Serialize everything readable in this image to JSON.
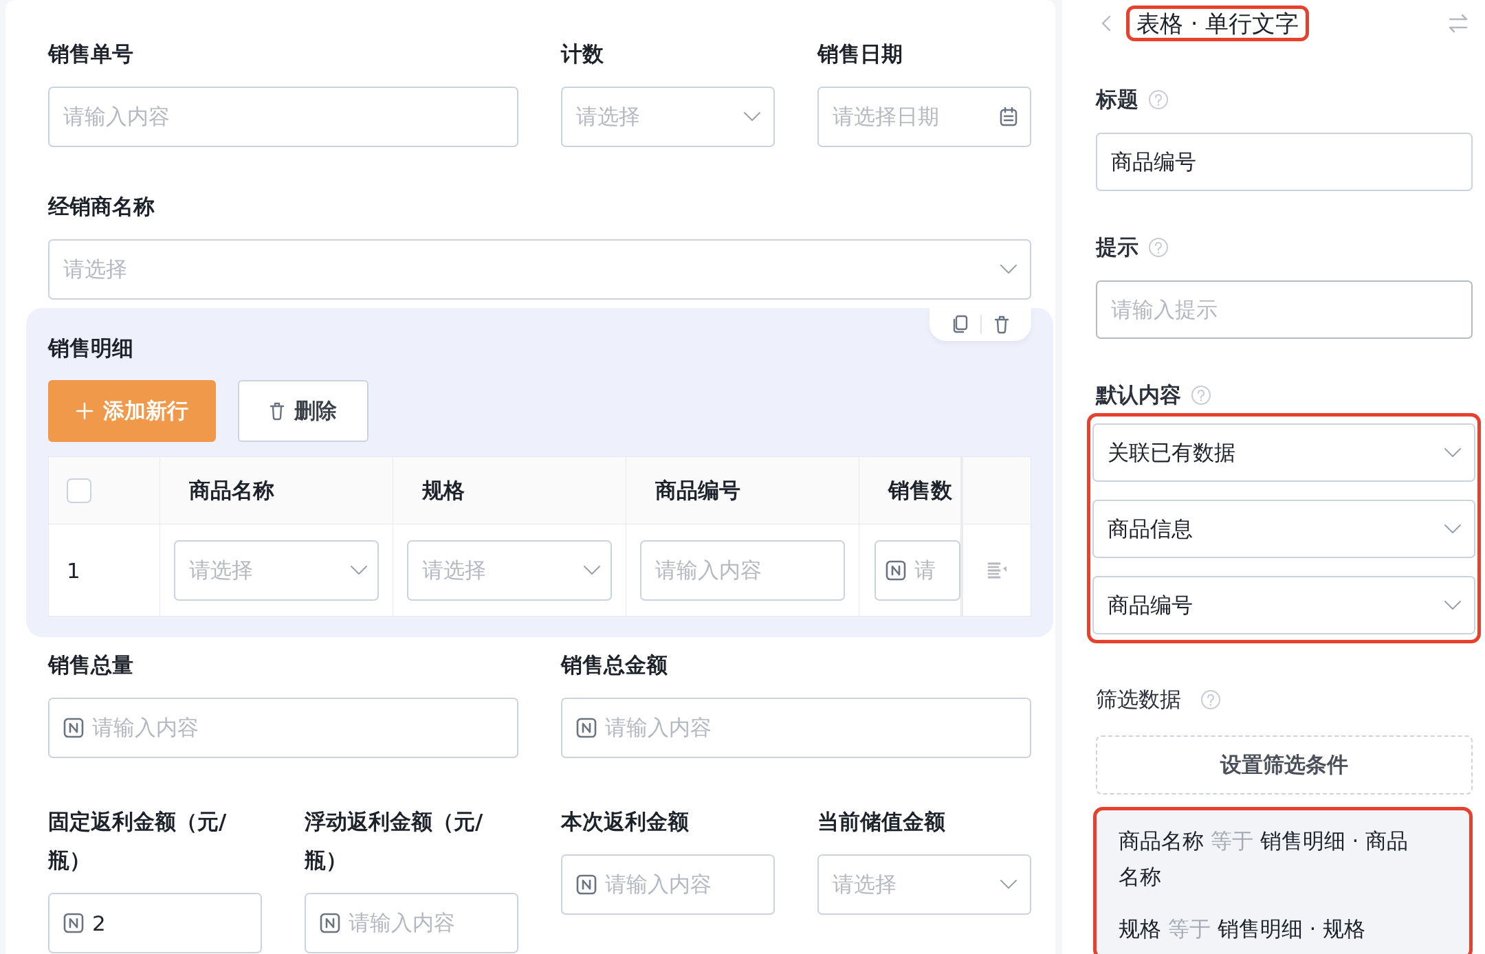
{
  "form": {
    "rows": [
      [
        {
          "label": "销售单号",
          "kind": "text",
          "placeholder": "请输入内容"
        },
        {
          "label": "计数",
          "kind": "select",
          "placeholder": "请选择"
        },
        {
          "label": "销售日期",
          "kind": "date",
          "placeholder": "请选择日期"
        }
      ],
      [
        {
          "label": "经销商名称",
          "kind": "select",
          "placeholder": "请选择"
        }
      ]
    ],
    "subtable": {
      "title": "销售明细",
      "add_button": "添加新行",
      "delete_button": "删除",
      "select_all_checked": false,
      "columns": [
        "商品名称",
        "规格",
        "商品编号",
        "销售数"
      ],
      "rows": [
        {
          "index": "1",
          "cells": [
            {
              "kind": "select",
              "placeholder": "请选择"
            },
            {
              "kind": "select",
              "placeholder": "请选择"
            },
            {
              "kind": "text",
              "placeholder": "请输入内容"
            },
            {
              "kind": "number",
              "placeholder": "请"
            }
          ]
        }
      ]
    },
    "rows_after": [
      [
        {
          "label": "销售总量",
          "kind": "number",
          "placeholder": "请输入内容"
        },
        {
          "label": "销售总金额",
          "kind": "number",
          "placeholder": "请输入内容"
        }
      ],
      [
        {
          "label": "固定返利金额（元/瓶）",
          "kind": "number",
          "value": "2"
        },
        {
          "label": "浮动返利金额（元/瓶）",
          "kind": "number",
          "placeholder": "请输入内容"
        },
        {
          "label": "本次返利金额",
          "kind": "number",
          "placeholder": "请输入内容"
        },
        {
          "label": "当前储值金额",
          "kind": "select",
          "placeholder": "请选择"
        }
      ]
    ]
  },
  "settings_panel": {
    "title": "表格 · 单行文字",
    "title_highlighted": true,
    "sections": [
      {
        "kind": "text",
        "label": "标题",
        "value": "商品编号"
      },
      {
        "kind": "text",
        "label": "提示",
        "placeholder": "请输入提示"
      },
      {
        "kind": "select_group",
        "label": "默认内容",
        "highlighted": true,
        "options": [
          "关联已有数据",
          "商品信息",
          "商品编号"
        ]
      },
      {
        "kind": "filter",
        "label": "筛选数据",
        "button": "设置筛选条件",
        "highlighted": true,
        "conditions": [
          {
            "field": "商品名称",
            "operator": "等于",
            "value": "销售明细 · 商品名称"
          },
          {
            "field": "规格",
            "operator": "等于",
            "value": "销售明细 · 规格"
          }
        ]
      }
    ]
  }
}
